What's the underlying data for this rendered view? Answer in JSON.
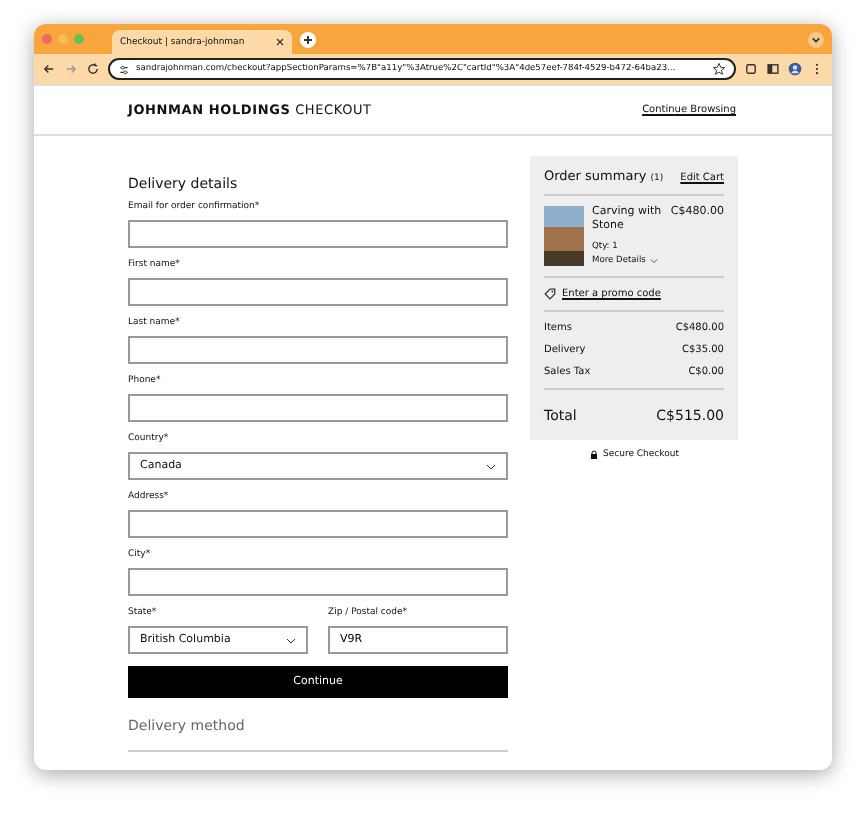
{
  "browser": {
    "tab_title": "Checkout | sandra-johnman",
    "url": "sandrajohnman.com/checkout?appSectionParams=%7B\"a11y\"%3Atrue%2C\"cartId\"%3A\"4de57eef-784f-4529-b472-64ba23..."
  },
  "header": {
    "brand_bold": "JOHNMAN HOLDINGS",
    "brand_rest": "CHECKOUT",
    "link": "Continue Browsing"
  },
  "delivery": {
    "title": "Delivery details",
    "rows": [
      [
        {
          "label": "Email for order confirmation*",
          "kind": "text"
        }
      ],
      [
        {
          "label": "First name*",
          "kind": "text"
        }
      ],
      [
        {
          "label": "Last name*",
          "kind": "text"
        }
      ],
      [
        {
          "label": "Phone*",
          "kind": "text"
        }
      ],
      [
        {
          "label": "Country*",
          "kind": "select",
          "value": "Canada"
        }
      ],
      [
        {
          "label": "Address*",
          "kind": "text"
        }
      ],
      [
        {
          "label": "City*",
          "kind": "text"
        }
      ],
      [
        {
          "label": "State*",
          "kind": "select",
          "value": "British Columbia"
        },
        {
          "label": "Zip / Postal code*",
          "kind": "text",
          "value": "V9R"
        }
      ]
    ],
    "button": "Continue",
    "next_section": "Delivery method"
  },
  "summary": {
    "title": "Order summary",
    "count": "(1)",
    "edit": "Edit Cart",
    "item": {
      "name": "Carving with Stone",
      "price": "C$480.00",
      "qty": "Qty: 1",
      "more": "More Details"
    },
    "promo": "Enter a promo code",
    "lines": [
      {
        "label": "Items",
        "value": "C$480.00"
      },
      {
        "label": "Delivery",
        "value": "C$35.00"
      },
      {
        "label": "Sales Tax",
        "value": "C$0.00"
      }
    ],
    "total_label": "Total",
    "total_value": "C$515.00",
    "secure": "Secure Checkout"
  }
}
